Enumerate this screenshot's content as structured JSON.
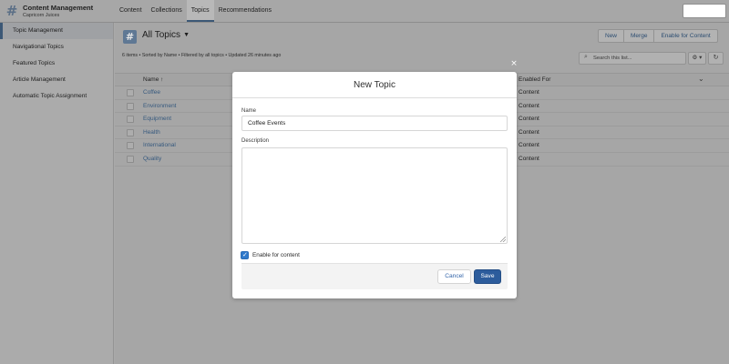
{
  "app": {
    "icon": "#",
    "title": "Content Management",
    "subtitle": "Capricorn Juices"
  },
  "nav_tabs": [
    {
      "label": "Content"
    },
    {
      "label": "Collections"
    },
    {
      "label": "Topics"
    },
    {
      "label": "Recommendations"
    }
  ],
  "active_tab": "Topics",
  "sidebar": {
    "items": [
      {
        "label": "Topic Management"
      },
      {
        "label": "Navigational Topics"
      },
      {
        "label": "Featured Topics"
      },
      {
        "label": "Article Management"
      },
      {
        "label": "Automatic Topic Assignment"
      }
    ],
    "active": "Topic Management"
  },
  "list": {
    "title": "All Topics",
    "meta": "6 items • Sorted by Name • Filtered by all topics • Updated 26 minutes ago",
    "buttons": {
      "new": "New",
      "merge": "Merge",
      "enable": "Enable for Content"
    },
    "search_placeholder": "Search this list...",
    "columns": {
      "name": "Name ↑",
      "enabled": "Enabled For"
    },
    "rows": [
      {
        "name": "Coffee",
        "enabled": "Content"
      },
      {
        "name": "Environment",
        "enabled": "Content"
      },
      {
        "name": "Equipment",
        "enabled": "Content"
      },
      {
        "name": "Health",
        "enabled": "Content"
      },
      {
        "name": "International",
        "enabled": "Content"
      },
      {
        "name": "Quality",
        "enabled": "Content"
      }
    ]
  },
  "modal": {
    "title": "New Topic",
    "close_glyph": "×",
    "name_label": "Name",
    "name_value": "Coffee Events",
    "description_label": "Description",
    "description_value": "",
    "enable_label": "Enable for content",
    "enable_checked": true,
    "cancel_label": "Cancel",
    "save_label": "Save"
  },
  "colors": {
    "accent": "#2c5c9c",
    "checkbox": "#2f79cb",
    "link": "#36597e"
  },
  "icons": {
    "app": "hash-icon",
    "search": "search-icon",
    "gear": "gear-icon",
    "refresh": "refresh-icon",
    "close": "close-icon",
    "dropdown": "chevron-down-icon",
    "check": "checkmark-icon"
  }
}
